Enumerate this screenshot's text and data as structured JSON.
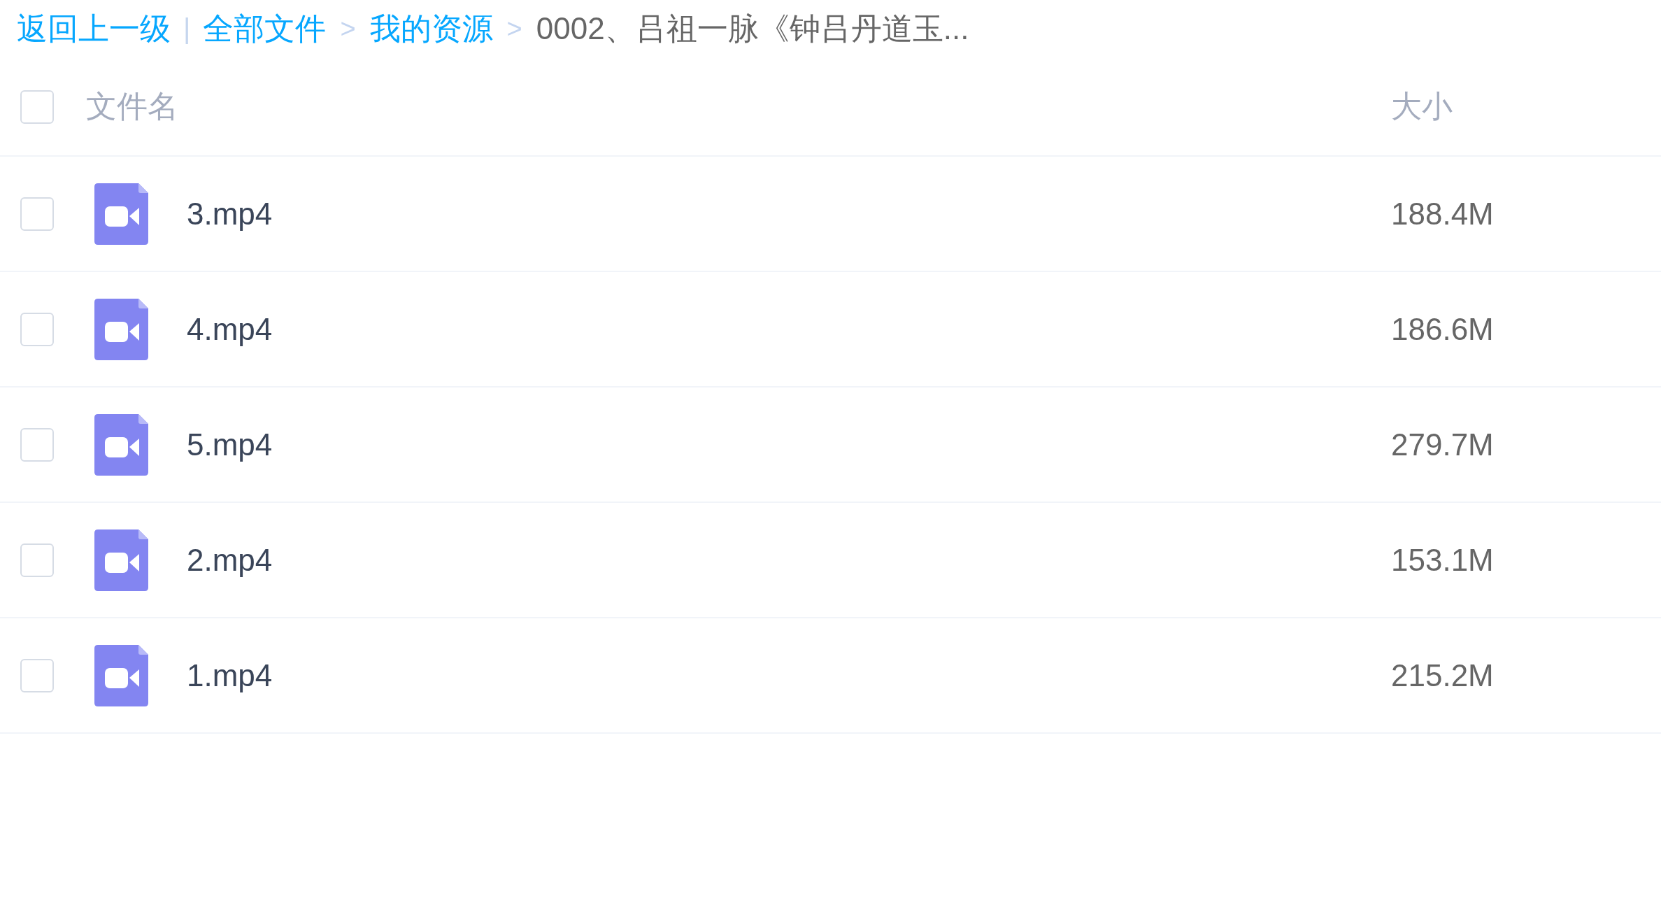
{
  "breadcrumb": {
    "back": "返回上一级",
    "divider": "|",
    "crumbs": [
      {
        "label": "全部文件",
        "kind": "link"
      },
      {
        "label": ">",
        "kind": "arrow"
      },
      {
        "label": "我的资源",
        "kind": "link"
      },
      {
        "label": ">",
        "kind": "arrow"
      },
      {
        "label": "0002、吕祖一脉《钟吕丹道玉...",
        "kind": "current"
      }
    ]
  },
  "table": {
    "select_all": {
      "checked": false
    },
    "columns": [
      "文件名",
      "大小"
    ],
    "rows": [
      {
        "name": "3.mp4",
        "size": "188.4M",
        "checked": false
      },
      {
        "name": "4.mp4",
        "size": "186.6M",
        "checked": false
      },
      {
        "name": "5.mp4",
        "size": "279.7M",
        "checked": false
      },
      {
        "name": "2.mp4",
        "size": "153.1M",
        "checked": false
      },
      {
        "name": "1.mp4",
        "size": "215.2M",
        "checked": false
      }
    ]
  }
}
